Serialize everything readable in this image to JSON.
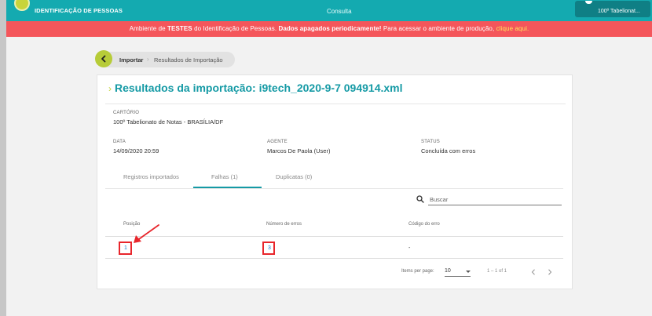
{
  "header": {
    "brand": "IDENTIFICAÇÃO DE PESSOAS",
    "center_label": "Consulta",
    "user_name": "100º Tabelionat..."
  },
  "banner": {
    "part1": "Ambiente de ",
    "part2": "TESTES",
    "part3": " do Identificação de Pessoas. ",
    "part4": "Dados apagados periodicamente!",
    "part5": " Para acessar o ambiente de produção, ",
    "link": "clique aqui."
  },
  "breadcrumb": {
    "items": [
      "Importar",
      "Resultados de Importação"
    ]
  },
  "page": {
    "title": "Resultados da importação: i9tech_2020-9-7 094914.xml"
  },
  "details": {
    "cartorio_label": "CARTÓRIO",
    "cartorio_value": "100º Tabelionato de Notas - BRASÍLIA/DF",
    "data_label": "DATA",
    "data_value": "14/09/2020 20:59",
    "agente_label": "AGENTE",
    "agente_value": "Marcos De Paola (User)",
    "status_label": "STATUS",
    "status_value": "Concluída com erros"
  },
  "tabs": [
    {
      "label": "Registros importados"
    },
    {
      "label": "Falhas (1)"
    },
    {
      "label": "Duplicatas (0)"
    }
  ],
  "search": {
    "placeholder": "Buscar"
  },
  "table": {
    "headers": [
      "Posição",
      "Número de erros",
      "Código do erro"
    ],
    "rows": [
      {
        "posicao": "1",
        "numero_erros": "3",
        "codigo_erro": "-"
      }
    ]
  },
  "pagination": {
    "items_label": "Items per page:",
    "per_page": "10",
    "range": "1 – 1 of 1"
  },
  "colors": {
    "header_bg": "#14aab0",
    "banner_bg": "#f4565b",
    "accent": "#159aa5",
    "back_button": "#b7cc38",
    "highlight": "#e8262c"
  }
}
